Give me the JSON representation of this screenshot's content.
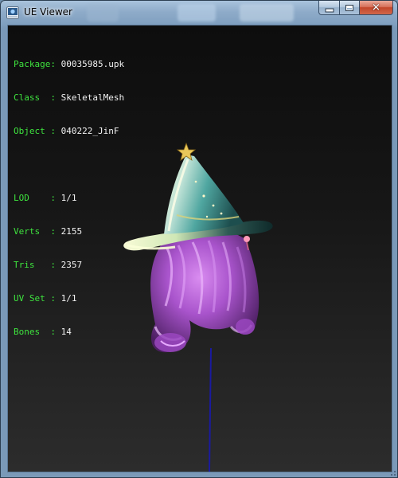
{
  "window": {
    "title": "UE Viewer",
    "close_glyph": "✕"
  },
  "info": {
    "package": {
      "label": "Package",
      "value": "00035985.upk"
    },
    "class": {
      "label": "Class",
      "value": "SkeletalMesh"
    },
    "object": {
      "label": "Object",
      "value": "040222_JinF"
    },
    "lod": {
      "label": "LOD",
      "value": "1/1"
    },
    "verts": {
      "label": "Verts",
      "value": "2155"
    },
    "tris": {
      "label": "Tris",
      "value": "2357"
    },
    "uv_set": {
      "label": "UV Set",
      "value": "1/1"
    },
    "bones": {
      "label": "Bones",
      "value": "14"
    }
  },
  "colors": {
    "label_green": "#3ee33e",
    "value_white": "#f2f2f2",
    "viewport_bg": "#1a1a1a",
    "hair_purple": "#b45cd6",
    "hat_teal": "#4fa6a0",
    "bone_blue": "#1a1aa0"
  },
  "icons": {
    "app": "ue-viewer-icon",
    "minimize": "minimize-icon",
    "maximize": "maximize-icon",
    "close": "close-icon"
  }
}
